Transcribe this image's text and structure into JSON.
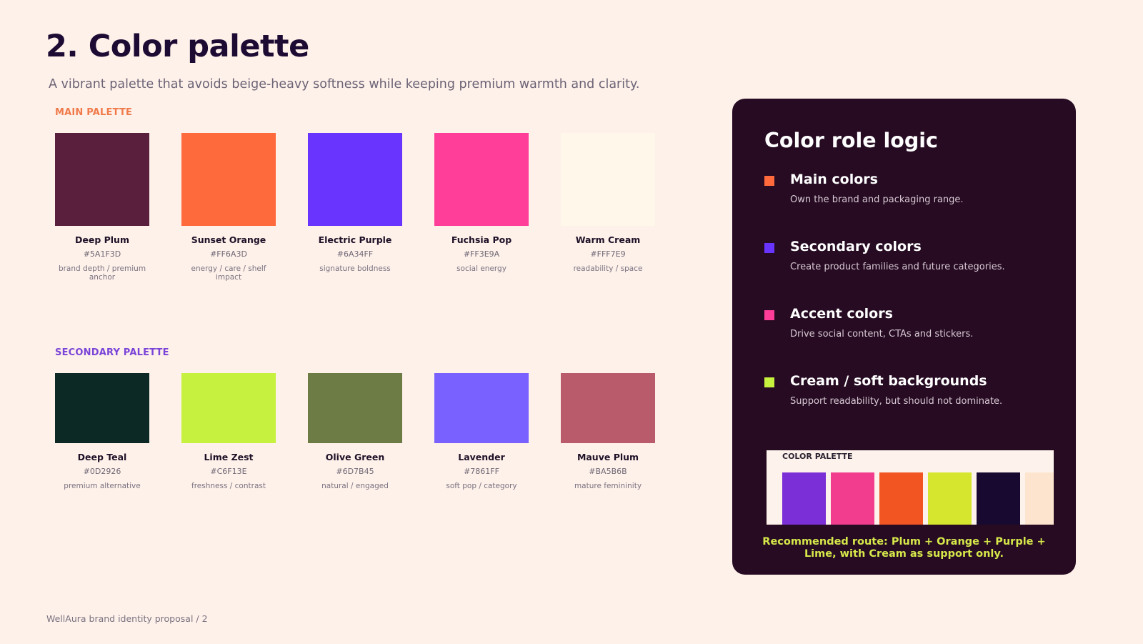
{
  "page": {
    "title": "2. Color palette",
    "subtitle": "A vibrant palette that avoids beige-heavy softness while keeping premium warmth and clarity.",
    "footer": "WellAura brand identity proposal / 2"
  },
  "main_palette": {
    "label": "MAIN PALETTE",
    "label_color": "#F07A4A",
    "swatches": [
      {
        "name": "Deep Plum",
        "hex": "#5A1F3D",
        "desc": "brand depth / premium anchor",
        "color": "#5A1F3D"
      },
      {
        "name": "Sunset Orange",
        "hex": "#FF6A3D",
        "desc": "energy / care / shelf impact",
        "color": "#FF6A3D"
      },
      {
        "name": "Electric Purple",
        "hex": "#6A34FF",
        "desc": "signature boldness",
        "color": "#6A34FF"
      },
      {
        "name": "Fuchsia Pop",
        "hex": "#FF3E9A",
        "desc": "social energy",
        "color": "#FF3E9A"
      },
      {
        "name": "Warm Cream",
        "hex": "#FFF7E9",
        "desc": "readability / space",
        "color": "#FFF7E9"
      }
    ]
  },
  "secondary_palette": {
    "label": "SECONDARY PALETTE",
    "label_color": "#7A44D8",
    "swatches": [
      {
        "name": "Deep Teal",
        "hex": "#0D2926",
        "desc": "premium alternative",
        "color": "#0D2926"
      },
      {
        "name": "Lime Zest",
        "hex": "#C6F13E",
        "desc": "freshness / contrast",
        "color": "#C6F13E"
      },
      {
        "name": "Olive Green",
        "hex": "#6D7B45",
        "desc": "natural / engaged",
        "color": "#6D7B45"
      },
      {
        "name": "Lavender",
        "hex": "#7861FF",
        "desc": "soft pop / category",
        "color": "#7861FF"
      },
      {
        "name": "Mauve Plum",
        "hex": "#BA5B6B",
        "desc": "mature femininity",
        "color": "#BA5B6B"
      }
    ]
  },
  "role_panel": {
    "title": "Color role logic",
    "background": "#260B22",
    "items": [
      {
        "name": "Main colors",
        "desc": "Own the brand and packaging range.",
        "color": "#FF6A3D"
      },
      {
        "name": "Secondary colors",
        "desc": "Create product families and future categories.",
        "color": "#6A34FF"
      },
      {
        "name": "Accent colors",
        "desc": "Drive social content, CTAs and stickers.",
        "color": "#FF3E9A"
      },
      {
        "name": "Cream / soft backgrounds",
        "desc": "Support readability, but should not dominate.",
        "color": "#C6F13E"
      }
    ],
    "mini_palette": {
      "label": "COLOR PALETTE",
      "colors": [
        "#7B2FD6",
        "#F23C8E",
        "#F25422",
        "#D6E52E",
        "#17092F",
        "#FDE4CF"
      ]
    },
    "recommendation": "Recommended route: Plum + Orange + Purple + Lime, with Cream as support only."
  }
}
